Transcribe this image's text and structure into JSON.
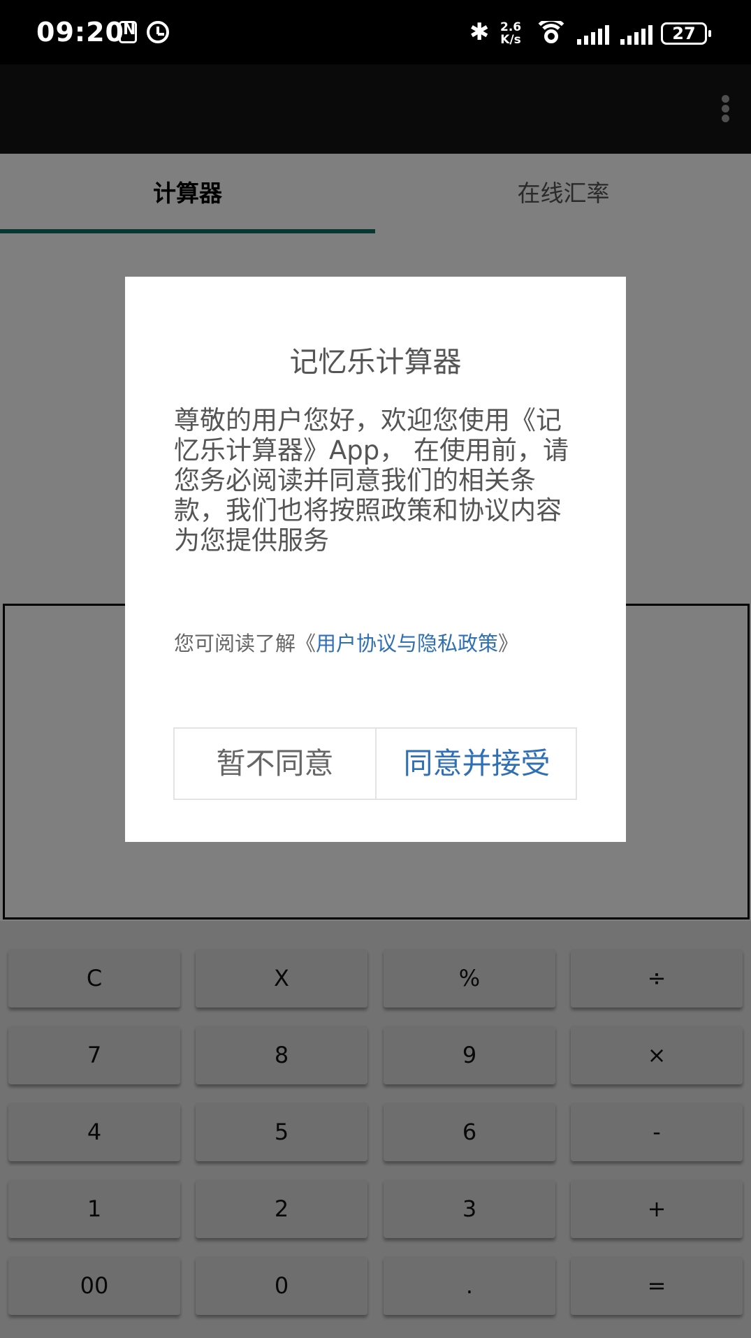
{
  "status_bar": {
    "time": "09:20",
    "net_speed_value": "2.6",
    "net_speed_unit": "K/s",
    "battery": "27"
  },
  "tabs": [
    {
      "label": "计算器",
      "active": true
    },
    {
      "label": "在线汇率",
      "active": false
    }
  ],
  "keypad": {
    "rows": [
      [
        "C",
        "X",
        "%",
        "÷"
      ],
      [
        "7",
        "8",
        "9",
        "×"
      ],
      [
        "4",
        "5",
        "6",
        "-"
      ],
      [
        "1",
        "2",
        "3",
        "+"
      ],
      [
        "00",
        "0",
        ".",
        "="
      ]
    ]
  },
  "dialog": {
    "title": "记忆乐计算器",
    "body": "尊敬的用户您好，欢迎您使用《记忆乐计算器》App， 在使用前，请您务必阅读并同意我们的相关条款，我们也将按照政策和协议内容为您提供服务",
    "policy_prefix": "您可阅读了解《",
    "policy_link": "用户协议与隐私政策",
    "policy_suffix": "》",
    "decline_label": "暂不同意",
    "accept_label": "同意并接受"
  },
  "colors": {
    "tab_indicator": "#116c63",
    "link_blue": "#2f6fb4"
  }
}
